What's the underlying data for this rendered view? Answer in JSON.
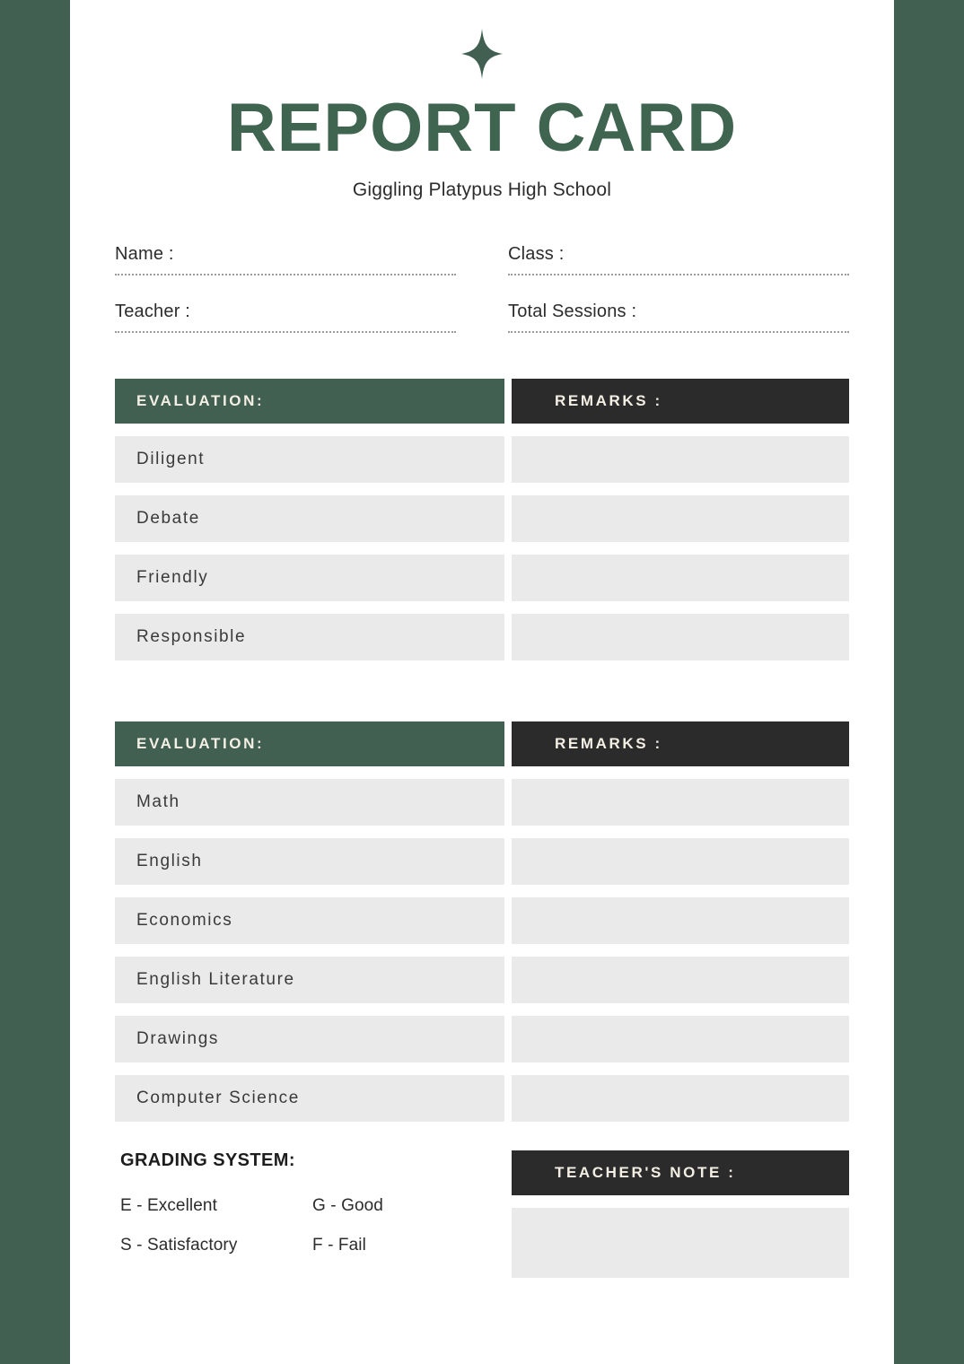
{
  "theme": {
    "green": "#416051",
    "dark": "#2B2B2B",
    "row_grey": "#EAEAEA",
    "cream": "#F4EFE4"
  },
  "header": {
    "star_icon": "four-point-star",
    "title": "REPORT CARD",
    "subtitle": "Giggling Platypus High School"
  },
  "form": {
    "fields": [
      {
        "label": "Name :",
        "value": ""
      },
      {
        "label": "Class :",
        "value": ""
      },
      {
        "label": "Teacher :",
        "value": ""
      },
      {
        "label": "Total Sessions :",
        "value": ""
      }
    ]
  },
  "behavior_table": {
    "header_left": "EVALUATION:",
    "header_right": "REMARKS :",
    "rows": [
      {
        "label": "Diligent",
        "remark": ""
      },
      {
        "label": "Debate",
        "remark": ""
      },
      {
        "label": "Friendly",
        "remark": ""
      },
      {
        "label": "Responsible",
        "remark": ""
      }
    ]
  },
  "subject_table": {
    "header_left": "EVALUATION:",
    "header_right": "REMARKS :",
    "rows": [
      {
        "label": "Math",
        "remark": ""
      },
      {
        "label": "English",
        "remark": ""
      },
      {
        "label": "Economics",
        "remark": ""
      },
      {
        "label": "English Literature",
        "remark": ""
      },
      {
        "label": "Drawings",
        "remark": ""
      },
      {
        "label": "Computer Science",
        "remark": ""
      }
    ]
  },
  "grading": {
    "title": "GRADING SYSTEM:",
    "items": [
      "E - Excellent",
      "G - Good",
      "S - Satisfactory",
      "F - Fail"
    ]
  },
  "teacher_note": {
    "header": "TEACHER'S NOTE :",
    "value": ""
  }
}
